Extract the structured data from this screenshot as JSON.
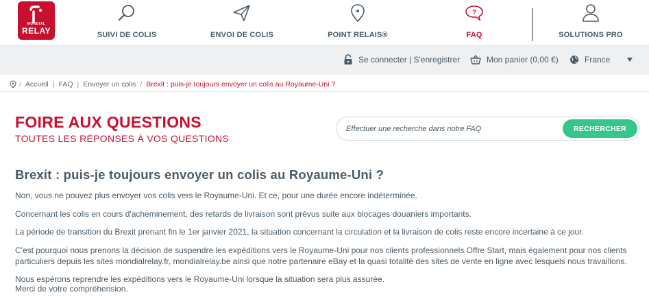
{
  "brand": {
    "line1": "MONDIAL",
    "line2": "RELAY",
    "color": "#c8102e"
  },
  "nav": {
    "items": [
      {
        "label": "SUIVI DE COLIS",
        "icon": "search-icon"
      },
      {
        "label": "ENVOI DE COLIS",
        "icon": "paper-plane-icon"
      },
      {
        "label": "POINT RELAIS®",
        "icon": "map-pin-icon"
      },
      {
        "label": "FAQ",
        "icon": "question-bubble-icon",
        "active": true
      },
      {
        "label": "SOLUTIONS PRO",
        "icon": "users-icon"
      }
    ]
  },
  "account": {
    "login": "Se connecter | S'enregistrer",
    "cart": "Mon panier (0,00 €)",
    "country": "France"
  },
  "breadcrumb": {
    "home": "Accueil",
    "faq": "FAQ",
    "section": "Envoyer un colis",
    "current": "Brexit : puis-je toujours envoyer un colis au Royaume-Uni ?"
  },
  "header": {
    "title": "FOIRE AUX QUESTIONS",
    "subtitle": "TOUTES LES RÉPONSES À VOS QUESTIONS"
  },
  "search": {
    "placeholder": "Effectuer une recherche dans notre FAQ",
    "button": "RECHERCHER",
    "accent": "#36c58a"
  },
  "article": {
    "question": "Brexit : puis-je toujours envoyer un colis au Royaume-Uni ?",
    "paragraphs": [
      "Non, vous ne pouvez plus envoyer vos colis vers le Royaume-Uni. Et ce, pour une durée encore indéterminée.",
      "Concernant les colis en cours d'acheminement, des retards de livraison sont prévus suite aux blocages douaniers importants.",
      "La période de transition du Brexit prenant fin le 1er janvier 2021, la situation concernant la circulation et la livraison de colis reste encore incertaine à ce jour.",
      "C'est pourquoi nous prenons la décision de suspendre les expéditions vers le Royaume-Uni pour nos clients professionnels Offre Start, mais également pour nos clients particuliers depuis les sites mondialrelay.fr, mondialrelay.be ainsi que notre partenaire eBay et la quasi totalité des sites de vente en ligne avec lesquels nous travaillons.",
      "Nous espérons reprendre les expéditions vers le Royaume-Uni lorsque la situation sera plus assurée.",
      "Merci de votre compréhension."
    ]
  }
}
